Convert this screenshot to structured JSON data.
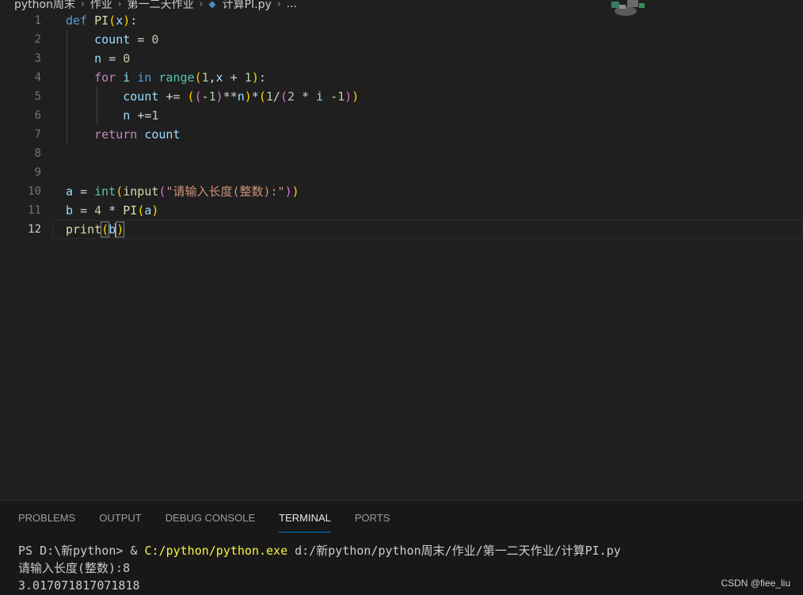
{
  "breadcrumb": {
    "items": [
      "python周末",
      "作业",
      "第一二天作业",
      "计算PI.py",
      "..."
    ],
    "separator": "›",
    "file_icon": "python-file-icon"
  },
  "editor": {
    "language": "python",
    "active_line": 12,
    "lines": [
      {
        "no": "1",
        "text": "def PI(x):"
      },
      {
        "no": "2",
        "text": "    count = 0"
      },
      {
        "no": "3",
        "text": "    n = 0"
      },
      {
        "no": "4",
        "text": "    for i in range(1,x + 1):"
      },
      {
        "no": "5",
        "text": "        count += ((-1)**n)*(1/(2 * i -1))"
      },
      {
        "no": "6",
        "text": "        n +=1"
      },
      {
        "no": "7",
        "text": "    return count"
      },
      {
        "no": "8",
        "text": ""
      },
      {
        "no": "9",
        "text": ""
      },
      {
        "no": "10",
        "text": "a = int(input(\"请输入长度(整数):\"))"
      },
      {
        "no": "11",
        "text": "b = 4 * PI(a)"
      },
      {
        "no": "12",
        "text": "print(b)"
      }
    ]
  },
  "panel": {
    "tabs": [
      "PROBLEMS",
      "OUTPUT",
      "DEBUG CONSOLE",
      "TERMINAL",
      "PORTS"
    ],
    "active_tab": "TERMINAL",
    "terminal": {
      "prompt": "PS D:\\新python> & ",
      "exe": "C:/python/python.exe",
      "arg": " d:/新python/python周末/作业/第一二天作业/计算PI.py",
      "input_line": "请输入长度(整数):8",
      "output_line": "3.017071817071818"
    }
  },
  "watermark": "CSDN @fiee_liu",
  "colors": {
    "background": "#1f1f1f",
    "panel_bg": "#181818",
    "keyword": "#569cd6",
    "control": "#c586c0",
    "function": "#dcdcaa",
    "variable": "#9cdcfe",
    "number": "#b5cea8",
    "string": "#ce9178",
    "accent": "#0078d4"
  }
}
